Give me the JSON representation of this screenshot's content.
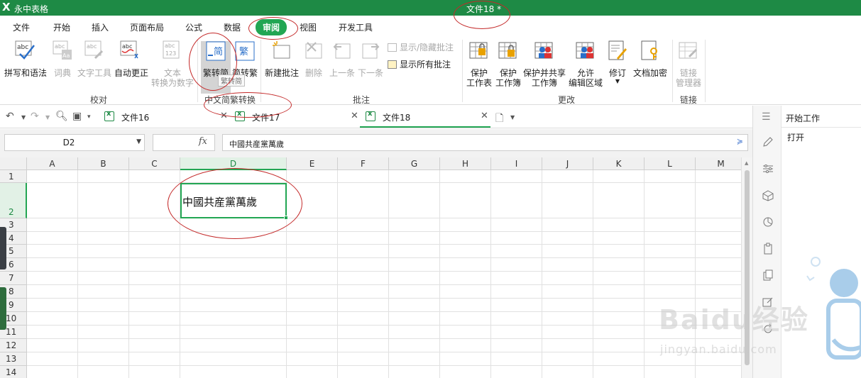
{
  "titlebar": {
    "logo": "X",
    "app_name": "永中表格",
    "document_title": "文件18 *"
  },
  "menu": {
    "items": [
      "文件",
      "开始",
      "插入",
      "页面布局",
      "公式",
      "数据",
      "审阅",
      "视图",
      "开发工具"
    ],
    "active": "审阅"
  },
  "ribbon": {
    "proof": {
      "spell": "拼写和语法",
      "dict": "词典",
      "text_tool": "文字工具",
      "autocorrect": "自动更正",
      "to_number_1": "文本",
      "to_number_2": "转换为数字",
      "group": "校对"
    },
    "chinese": {
      "to_simplified": "繁转简",
      "to_traditional": "简转繁",
      "icon_simplified": "简",
      "icon_traditional": "繁",
      "tooltip": "繁转简",
      "group": "中文简繁转换"
    },
    "comments": {
      "show_hide": "显示/隐藏批注",
      "show_all": "显示所有批注",
      "new": "新建批注",
      "delete": "删除",
      "prev": "上一条",
      "next": "下一条",
      "group": "批注"
    },
    "changes": {
      "protect_sheet_1": "保护",
      "protect_sheet_2": "工作表",
      "protect_book_1": "保护",
      "protect_book_2": "工作簿",
      "protect_share_1": "保护并共享",
      "protect_share_2": "工作簿",
      "allow_edit_1": "允许",
      "allow_edit_2": "编辑区域",
      "track": "修订",
      "encrypt": "文档加密",
      "group": "更改"
    },
    "links": {
      "manager_1": "链接",
      "manager_2": "管理器",
      "group": "链接"
    }
  },
  "tabs": [
    {
      "name": "文件16",
      "active": false
    },
    {
      "name": "文件17",
      "active": false
    },
    {
      "name": "文件18",
      "active": true
    }
  ],
  "formula_bar": {
    "cell_ref": "D2",
    "fx": "fx",
    "content": "中國共産黨萬歲"
  },
  "sheet": {
    "columns": [
      "A",
      "B",
      "C",
      "D",
      "E",
      "F",
      "G",
      "H",
      "I",
      "J",
      "K",
      "L",
      "M"
    ],
    "rows": [
      "1",
      "2",
      "3",
      "4",
      "5",
      "6",
      "7",
      "8",
      "9",
      "10",
      "11",
      "12",
      "13",
      "14"
    ],
    "selected_column": "D",
    "selected_row": "2",
    "active_cell_value": "中國共産黨萬歲"
  },
  "right_pane": {
    "title": "开始工作",
    "open_label": "打开"
  },
  "watermark": {
    "main": "Baidu经验",
    "sub": "jingyan.baidu.com"
  },
  "colors": {
    "accent": "#1e8a45",
    "active_tab": "#22a653",
    "annotation": "#c42a2a"
  }
}
